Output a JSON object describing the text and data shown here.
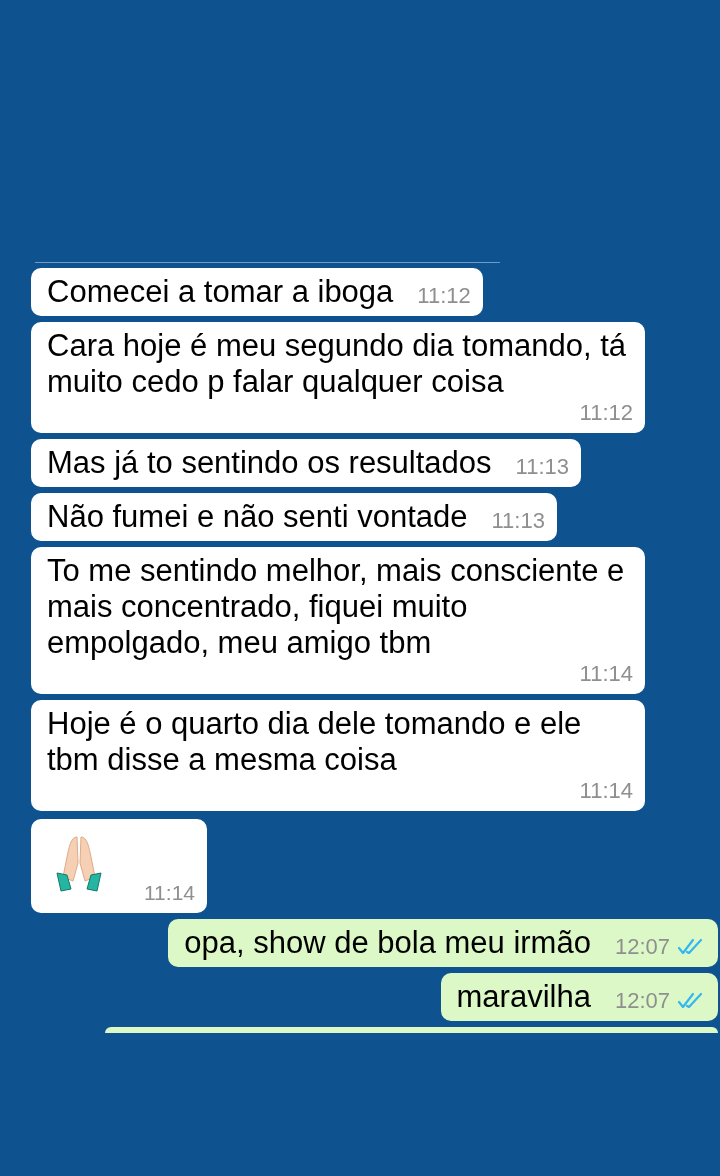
{
  "messages": [
    {
      "kind": "incoming",
      "text": "Comecei a tomar a iboga",
      "time": "11:12"
    },
    {
      "kind": "incoming",
      "text": "Cara hoje é meu segundo dia tomando, tá muito cedo p falar qualquer coisa",
      "time": "11:12"
    },
    {
      "kind": "incoming",
      "text": "Mas já to sentindo os resultados",
      "time": "11:13"
    },
    {
      "kind": "incoming",
      "text": "Não fumei e não senti vontade",
      "time": "11:13"
    },
    {
      "kind": "incoming",
      "text": "To me sentindo melhor, mais consciente e mais concentrado, fiquei muito empolgado, meu amigo tbm",
      "time": "11:14"
    },
    {
      "kind": "incoming",
      "text": "Hoje é o quarto dia dele tomando e ele tbm disse a mesma coisa",
      "time": "11:14"
    },
    {
      "kind": "emoji",
      "time": "11:14"
    },
    {
      "kind": "outgoing",
      "text": "opa, show de bola meu irmão",
      "time": "12:07",
      "read": true
    },
    {
      "kind": "outgoing",
      "text": "maravilha",
      "time": "12:07",
      "read": true
    },
    {
      "kind": "cutoff"
    }
  ]
}
